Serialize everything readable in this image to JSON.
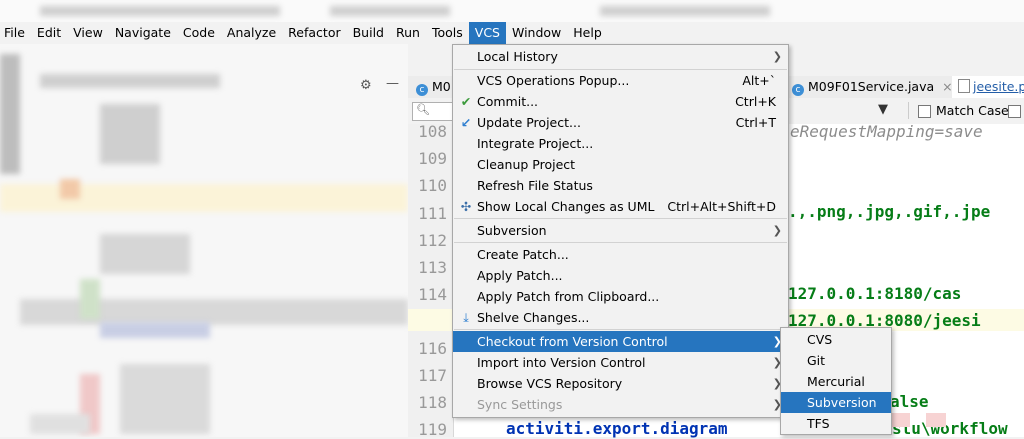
{
  "menubar": {
    "items": [
      {
        "label": "File"
      },
      {
        "label": "Edit"
      },
      {
        "label": "View"
      },
      {
        "label": "Navigate"
      },
      {
        "label": "Code"
      },
      {
        "label": "Analyze"
      },
      {
        "label": "Refactor"
      },
      {
        "label": "Build"
      },
      {
        "label": "Run"
      },
      {
        "label": "Tools"
      },
      {
        "label": "VCS"
      },
      {
        "label": "Window"
      },
      {
        "label": "Help"
      }
    ]
  },
  "tabs": [
    {
      "label": "M0",
      "icon": "C"
    },
    {
      "label": "M09F01Service.java",
      "icon": "C"
    },
    {
      "label": "jeesite.pr"
    }
  ],
  "findbar": {
    "match_case": "Match Case"
  },
  "gutter": {
    "lines": [
      "108",
      "109",
      "110",
      "111",
      "112",
      "113",
      "114",
      "115",
      "116",
      "117",
      "118",
      "119"
    ]
  },
  "code": {
    "l108": "eRequestMapping=save",
    "l111": ".,.png,.jpg,.gif,.jpe",
    "l114": "127.0.0.1:8180/cas",
    "l115": "127.0.0.1:8080/jeesi",
    "l118": "alse",
    "l119a": "activiti.export.diagram",
    "l119b": "stu\\workflow"
  },
  "vcs_menu": {
    "items": [
      {
        "label": "Local History",
        "submenu": true
      },
      {
        "label": "VCS Operations Popup...",
        "shortcut": "Alt+`"
      },
      {
        "label": "Commit...",
        "shortcut": "Ctrl+K",
        "icon": "check"
      },
      {
        "label": "Update Project...",
        "shortcut": "Ctrl+T",
        "icon": "update"
      },
      {
        "label": "Integrate Project..."
      },
      {
        "label": "Cleanup Project"
      },
      {
        "label": "Refresh File Status"
      },
      {
        "label": "Show Local Changes as UML",
        "shortcut": "Ctrl+Alt+Shift+D",
        "icon": "uml"
      },
      {
        "label": "Subversion",
        "submenu": true
      },
      {
        "label": "Create Patch..."
      },
      {
        "label": "Apply Patch..."
      },
      {
        "label": "Apply Patch from Clipboard..."
      },
      {
        "label": "Shelve Changes...",
        "icon": "shelve"
      },
      {
        "label": "Checkout from Version Control",
        "submenu": true,
        "selected": true
      },
      {
        "label": "Import into Version Control",
        "submenu": true
      },
      {
        "label": "Browse VCS Repository",
        "submenu": true
      },
      {
        "label": "Sync Settings",
        "submenu": true,
        "disabled": true
      }
    ]
  },
  "checkout_submenu": {
    "items": [
      {
        "label": "CVS"
      },
      {
        "label": "Git"
      },
      {
        "label": "Mercurial"
      },
      {
        "label": "Subversion",
        "selected": true
      },
      {
        "label": "TFS"
      }
    ]
  },
  "colors": {
    "selection": "#2675bf",
    "code_green": "#067d17",
    "code_blue": "#0033b3"
  }
}
